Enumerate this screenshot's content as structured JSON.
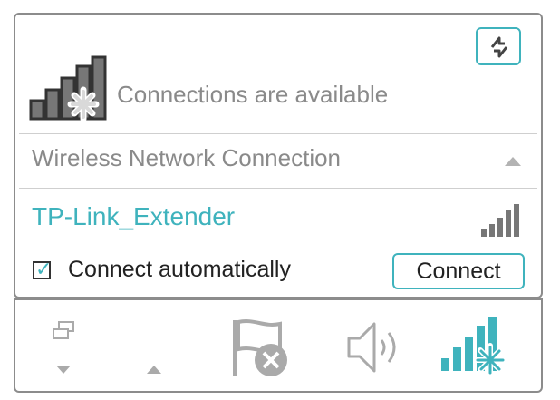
{
  "status": {
    "text": "Connections are available",
    "icon": "network-signal-star-icon"
  },
  "refresh": {
    "icon": "refresh-arrows-icon"
  },
  "section": {
    "title": "Wireless Network Connection",
    "toggle_icon": "chevron-up-icon"
  },
  "network": {
    "name": "TP-Link_Extender",
    "signal_icon": "signal-strength-icon",
    "auto_connect_checked": true,
    "auto_connect_label": "Connect automatically",
    "connect_label": "Connect"
  },
  "taskbar": {
    "items": [
      "display-icon",
      "chevron-down-icon",
      "chevron-up-icon",
      "action-center-flag-icon",
      "volume-icon",
      "wireless-network-icon"
    ]
  },
  "colors": {
    "accent": "#3fb3bd",
    "muted_text": "#8a8a8a",
    "border": "#8c8c8c"
  }
}
